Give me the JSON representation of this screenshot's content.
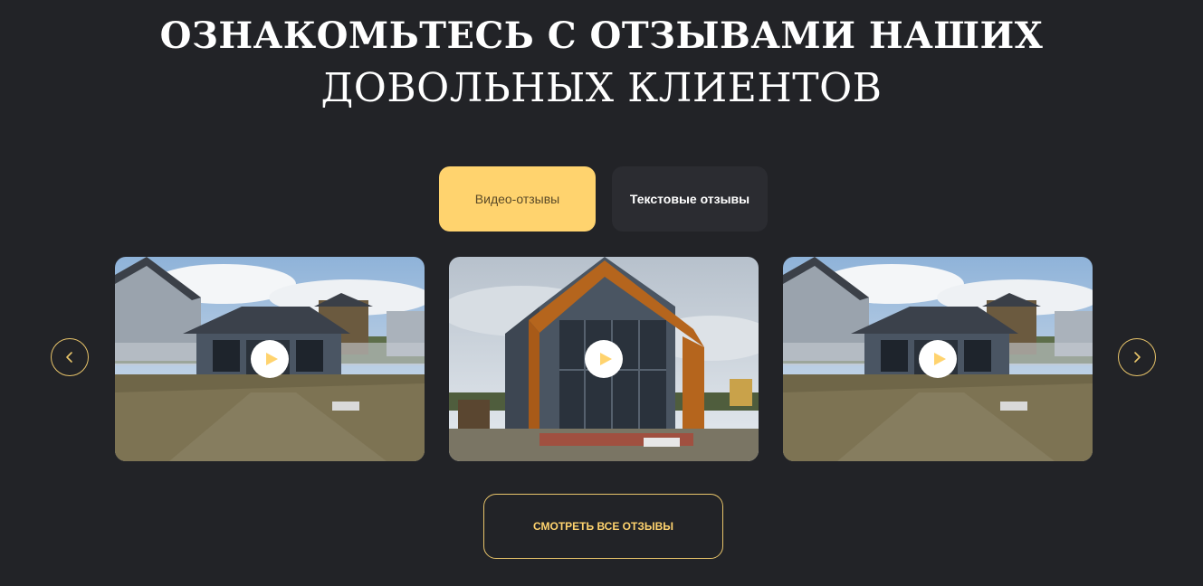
{
  "heading": {
    "line1": "ОЗНАКОМЬТЕСЬ С ОТЗЫВАМИ НАШИХ",
    "line2": "ДОВОЛЬНЫХ КЛИЕНТОВ"
  },
  "tabs": [
    {
      "label": "Видео-отзывы",
      "active": true
    },
    {
      "label": "Текстовые отзывы",
      "active": false
    }
  ],
  "carousel": {
    "prev_icon": "chevron-left-icon",
    "next_icon": "chevron-right-icon",
    "cards": [
      {
        "scene": "single-storey-house",
        "icon": "play-icon"
      },
      {
        "scene": "barnhouse-wood-frame",
        "icon": "play-icon"
      },
      {
        "scene": "single-storey-house",
        "icon": "play-icon"
      }
    ]
  },
  "cta": {
    "label": "СМОТРЕТЬ ВСЕ ОТЗЫВЫ"
  },
  "colors": {
    "background": "#222327",
    "accent": "#ffd36e",
    "accent_border": "#e8c46a",
    "tab_inactive": "#2b2c31"
  }
}
